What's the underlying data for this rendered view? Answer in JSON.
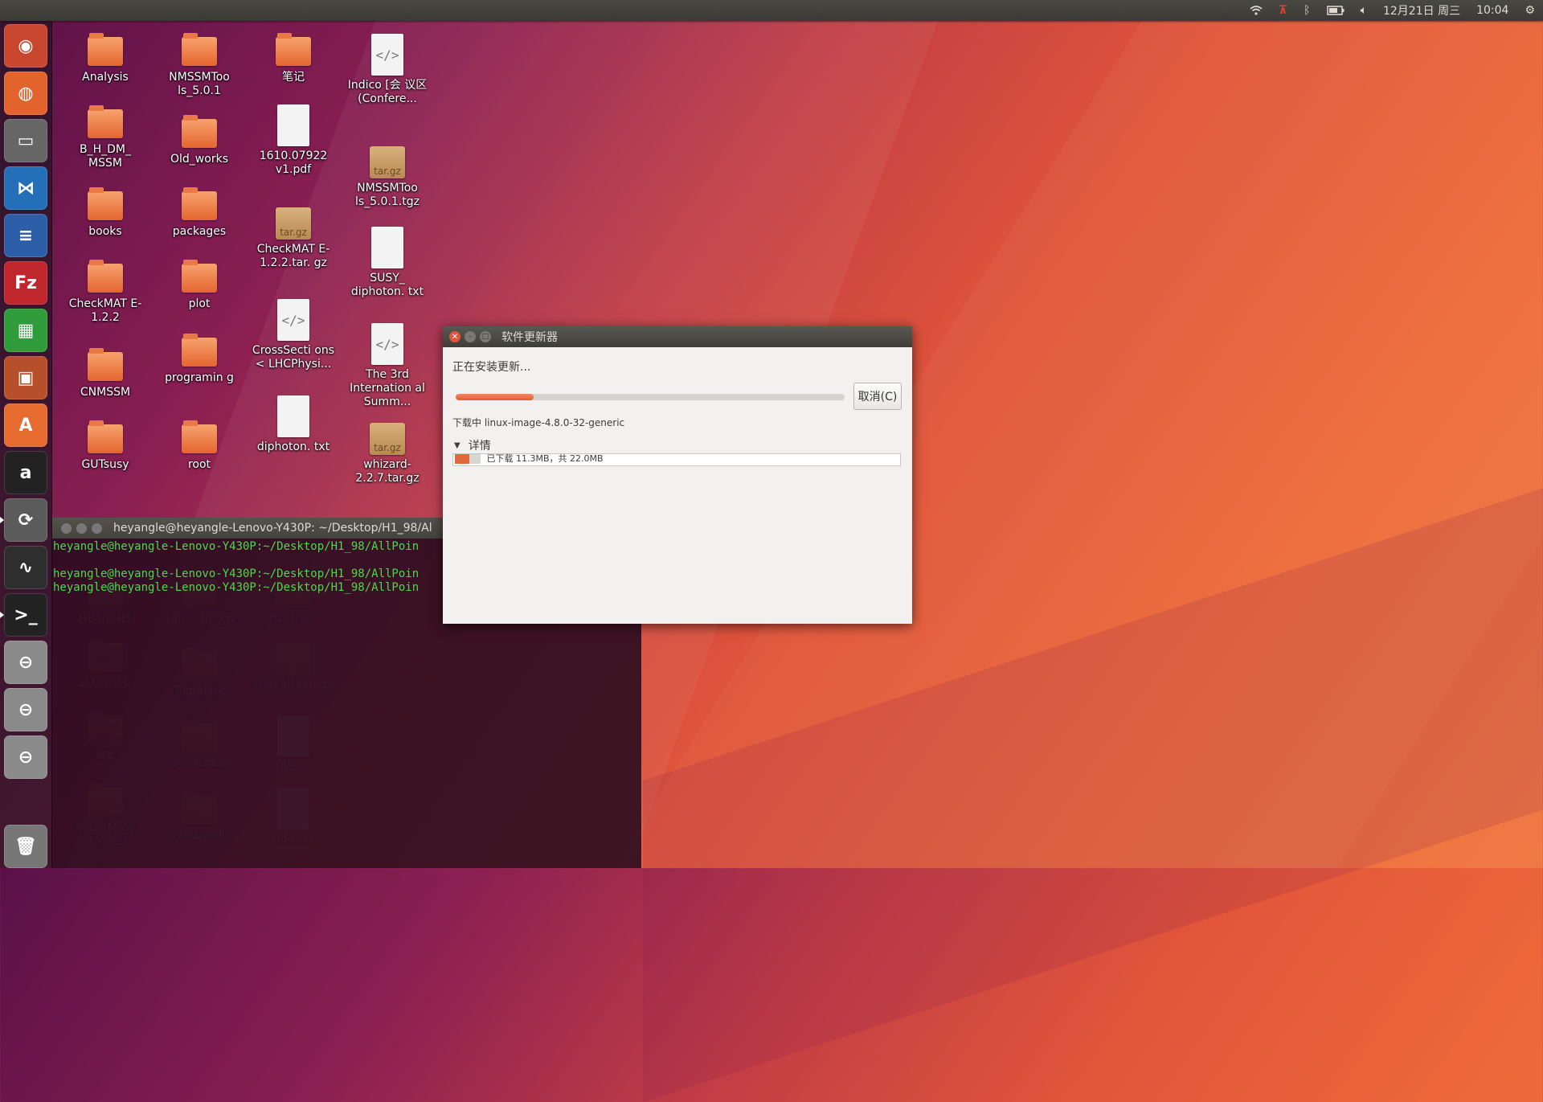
{
  "top_panel": {
    "date": "12月21日 周三",
    "time": "10:04",
    "icons": [
      "wifi-icon",
      "input-method-icon",
      "bluetooth-icon",
      "battery-icon",
      "volume-icon",
      "gear-icon"
    ]
  },
  "launcher": {
    "items": [
      {
        "name": "ubuntu-dash",
        "glyph": "◉"
      },
      {
        "name": "firefox",
        "glyph": "◍"
      },
      {
        "name": "files",
        "glyph": "▭"
      },
      {
        "name": "vscode",
        "glyph": "⋈"
      },
      {
        "name": "libreoffice-writer",
        "glyph": "≡"
      },
      {
        "name": "filezilla",
        "glyph": "Fz"
      },
      {
        "name": "libreoffice-calc",
        "glyph": "▦"
      },
      {
        "name": "libreoffice-impress",
        "glyph": "▣"
      },
      {
        "name": "software-center",
        "glyph": "A"
      },
      {
        "name": "amazon",
        "glyph": "a"
      },
      {
        "name": "software-updater",
        "glyph": "⟳"
      },
      {
        "name": "system-monitor",
        "glyph": "∿"
      },
      {
        "name": "terminal",
        "glyph": ">_"
      },
      {
        "name": "disk-1",
        "glyph": "⊖"
      },
      {
        "name": "disk-2",
        "glyph": "⊖"
      },
      {
        "name": "disk-3",
        "glyph": "⊖"
      },
      {
        "name": "trash",
        "glyph": "🗑"
      }
    ]
  },
  "desktop": {
    "icons": [
      {
        "label": "Analysis",
        "type": "folder"
      },
      {
        "label": "B_H_DM_ MSSM",
        "type": "folder"
      },
      {
        "label": "books",
        "type": "folder"
      },
      {
        "label": "CheckMAT E-1.2.2",
        "type": "folder"
      },
      {
        "label": "CNMSSM",
        "type": "folder"
      },
      {
        "label": "GUTsusy",
        "type": "folder"
      },
      {
        "label": "NMSSMToo ls_5.0.1",
        "type": "folder"
      },
      {
        "label": "Old_works",
        "type": "folder"
      },
      {
        "label": "packages",
        "type": "folder"
      },
      {
        "label": "plot",
        "type": "folder"
      },
      {
        "label": "programin g",
        "type": "folder"
      },
      {
        "label": "root",
        "type": "folder"
      },
      {
        "label": "笔记",
        "type": "folder"
      },
      {
        "label": "1610.07922 v1.pdf",
        "type": "doc"
      },
      {
        "label": "CheckMAT E-1.2.2.tar. gz",
        "type": "pkg"
      },
      {
        "label": "CrossSecti ons < LHCPhysi...",
        "type": "html"
      },
      {
        "label": "diphoton. txt",
        "type": "doc"
      },
      {
        "label": "Indico [会 议区 (Confere...",
        "type": "html"
      },
      {
        "label": "NMSSMToo ls_5.0.1.tgz",
        "type": "pkg"
      },
      {
        "label": "SUSY_ diphoton. txt",
        "type": "doc"
      },
      {
        "label": "The 3rd Internation al Summ...",
        "type": "html"
      },
      {
        "label": "whizard- 2.2.7.tar.gz",
        "type": "pkg"
      },
      {
        "label": "HBandHS",
        "type": "folder"
      },
      {
        "label": "LUX2016",
        "type": "folder"
      },
      {
        "label": "MC",
        "type": "folder"
      },
      {
        "label": "NMSSMToo ls_4.9.3",
        "type": "folder"
      },
      {
        "label": "Spin_ 3higgs",
        "type": "folder"
      },
      {
        "label": "Template",
        "type": "folder"
      },
      {
        "label": "Vevacious",
        "type": "folder"
      },
      {
        "label": "Whizard",
        "type": "folder"
      },
      {
        "label": "ftp_htu2",
        "type": "folder"
      },
      {
        "label": "h2_Full.tar. gz",
        "type": "pkg"
      },
      {
        "label": "htu2",
        "type": "doc"
      },
      {
        "label": "Hdecay",
        "type": "doc"
      }
    ],
    "pkg_badge": "tar.gz",
    "html_glyph": "</>"
  },
  "terminal": {
    "title": "heyangle@heyangle-Lenovo-Y430P: ~/Desktop/H1_98/Al",
    "lines": [
      "heyangle@heyangle-Lenovo-Y430P:~/Desktop/H1_98/AllPoin",
      "",
      "heyangle@heyangle-Lenovo-Y430P:~/Desktop/H1_98/AllPoin",
      "heyangle@heyangle-Lenovo-Y430P:~/Desktop/H1_98/AllPoin"
    ]
  },
  "dialog": {
    "title": "软件更新器",
    "status": "正在安装更新...",
    "cancel": "取消(C)",
    "downloading": "下载中 linux-image-4.8.0-32-generic",
    "details_label": "详情",
    "detail_text": "已下载 11.3MB，共 22.0MB",
    "progress": 0.2
  }
}
